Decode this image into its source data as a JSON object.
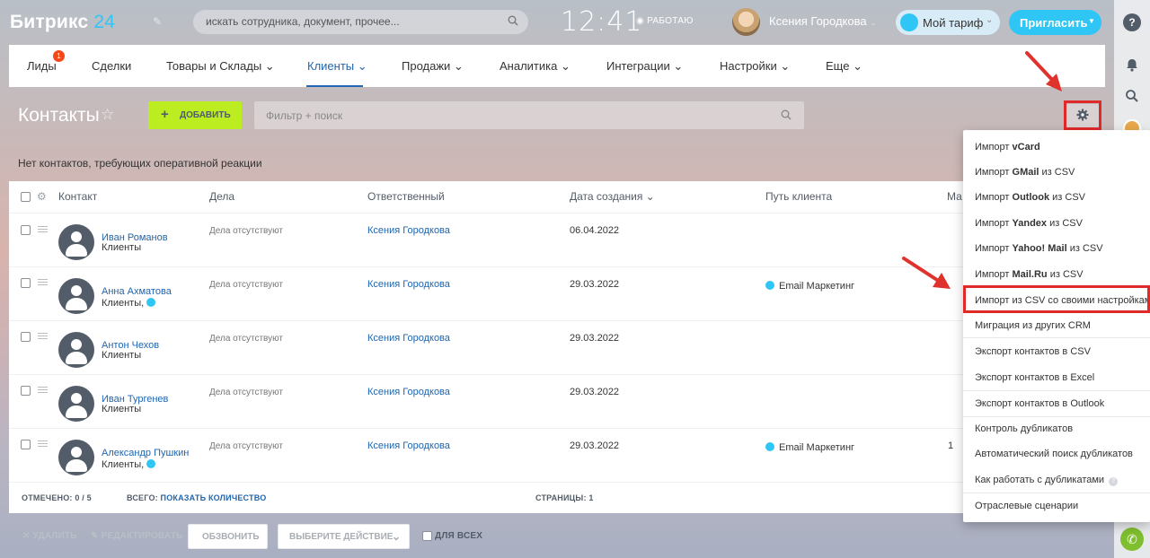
{
  "header": {
    "logo_text": "Битрикс",
    "logo_num": "24",
    "search_placeholder": "искать сотрудника, документ, прочее...",
    "time": "12:41",
    "work_status": "РАБОТАЮ",
    "user_name": "Ксения Городкова",
    "tariff_label": "Мой тариф",
    "invite_label": "Пригласить"
  },
  "nav": {
    "items": [
      {
        "label": "Лиды",
        "badge": "1"
      },
      {
        "label": "Сделки"
      },
      {
        "label": "Товары и Склады"
      },
      {
        "label": "Клиенты"
      },
      {
        "label": "Продажи"
      },
      {
        "label": "Аналитика"
      },
      {
        "label": "Интеграции"
      },
      {
        "label": "Настройки"
      },
      {
        "label": "Еще"
      }
    ]
  },
  "toolbar": {
    "title": "Контакты",
    "add_label": "ДОБАВИТЬ",
    "filter_placeholder": "Фильтр + поиск"
  },
  "notice": "Нет контактов, требующих оперативной реакции",
  "table": {
    "columns": [
      "Контакт",
      "Дела",
      "Ответственный",
      "Дата создания",
      "Путь клиента",
      "Ма"
    ],
    "rows": [
      {
        "name": "Иван Романов",
        "sub": "Клиенты",
        "deals": "Дела отсутствуют",
        "resp": "Ксения Городкова",
        "date": "06.04.2022",
        "path": "",
        "extra": ""
      },
      {
        "name": "Анна Ахматова",
        "sub": "Клиенты,",
        "deals": "Дела отсутствуют",
        "resp": "Ксения Городкова",
        "date": "29.03.2022",
        "path": "Email Маркетинг",
        "extra": ""
      },
      {
        "name": "Антон Чехов",
        "sub": "Клиенты",
        "deals": "Дела отсутствуют",
        "resp": "Ксения Городкова",
        "date": "29.03.2022",
        "path": "",
        "extra": ""
      },
      {
        "name": "Иван Тургенев",
        "sub": "Клиенты",
        "deals": "Дела отсутствуют",
        "resp": "Ксения Городкова",
        "date": "29.03.2022",
        "path": "",
        "extra": ""
      },
      {
        "name": "Александр Пушкин",
        "sub": "Клиенты,",
        "deals": "Дела отсутствуют",
        "resp": "Ксения Городкова",
        "date": "29.03.2022",
        "path": "Email Маркетинг",
        "extra": "1"
      }
    ],
    "footer": {
      "marked_label": "ОТМЕЧЕНО:",
      "marked_value": "0 / 5",
      "total_label": "ВСЕГО:",
      "total_link": "ПОКАЗАТЬ КОЛИЧЕСТВО",
      "pages_label": "СТРАНИЦЫ:",
      "pages_value": "1"
    }
  },
  "actions": {
    "delete": "УДАЛИТЬ",
    "edit": "РЕДАКТИРОВАТЬ",
    "call": "ОБЗВОНИТЬ",
    "choose": "ВЫБЕРИТЕ ДЕЙСТВИЕ",
    "for_all": "ДЛЯ ВСЕХ"
  },
  "menu": {
    "items": [
      {
        "pre": "Импорт ",
        "bold": "vCard",
        "post": ""
      },
      {
        "pre": "Импорт ",
        "bold": "GMail",
        "post": " из CSV"
      },
      {
        "pre": "Импорт ",
        "bold": "Outlook",
        "post": " из CSV"
      },
      {
        "pre": "Импорт ",
        "bold": "Yandex",
        "post": " из CSV"
      },
      {
        "pre": "Импорт ",
        "bold": "Yahoo! Mail",
        "post": " из CSV"
      },
      {
        "pre": "Импорт ",
        "bold": "Mail.Ru",
        "post": " из CSV"
      },
      {
        "pre": "Импорт из CSV со своими настройками",
        "bold": "",
        "post": ""
      },
      {
        "pre": "Миграция из других CRM",
        "bold": "",
        "post": ""
      },
      {
        "pre": "Экспорт контактов в CSV",
        "bold": "",
        "post": ""
      },
      {
        "pre": "Экспорт контактов в Excel",
        "bold": "",
        "post": ""
      },
      {
        "pre": "Экспорт контактов в Outlook",
        "bold": "",
        "post": ""
      },
      {
        "pre": "Контроль дубликатов",
        "bold": "",
        "post": ""
      },
      {
        "pre": "Автоматический поиск дубликатов",
        "bold": "",
        "post": ""
      },
      {
        "pre": "Как работать с дубликатами",
        "bold": "",
        "post": ""
      },
      {
        "pre": "Отраслевые сценарии",
        "bold": "",
        "post": ""
      }
    ]
  },
  "colors": {
    "accent": "#2fc6f6",
    "link": "#2066b0",
    "add_button": "#bbed21",
    "highlight": "#e02a2a",
    "badge": "#f54819"
  }
}
